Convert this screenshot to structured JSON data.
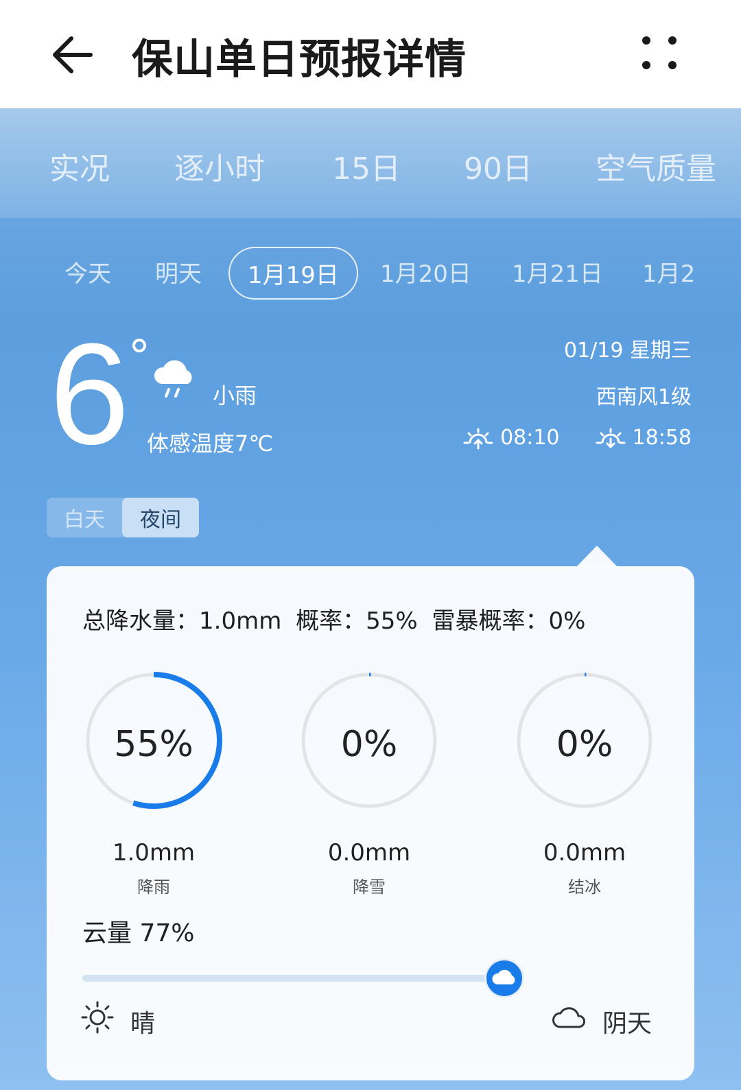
{
  "header": {
    "title": "保山单日预报详情"
  },
  "main_tabs": [
    {
      "label": "实况"
    },
    {
      "label": "逐小时"
    },
    {
      "label": "15日"
    },
    {
      "label": "90日"
    },
    {
      "label": "空气质量"
    }
  ],
  "date_tabs": [
    {
      "label": "今天"
    },
    {
      "label": "明天"
    },
    {
      "label": "1月19日",
      "selected": true
    },
    {
      "label": "1月20日"
    },
    {
      "label": "1月21日"
    },
    {
      "label": "1月2"
    }
  ],
  "summary": {
    "temperature": "6",
    "condition": "小雨",
    "condition_icon": "light-rain-icon",
    "feels_like": "体感温度7℃",
    "date": "01/19 星期三",
    "wind": "西南风1级",
    "sunrise": "08:10",
    "sunset": "18:58"
  },
  "toggle": {
    "day_label": "白天",
    "night_label": "夜间",
    "selected": "night"
  },
  "card": {
    "total_precip": "总降水量：1.0mm",
    "probability": "概率：55%",
    "thunder_probability": "雷暴概率：0%",
    "gauges": [
      {
        "value": "55%",
        "fraction": 0.55,
        "amount": "1.0mm",
        "label": "降雨"
      },
      {
        "value": "0%",
        "fraction": 0,
        "amount": "0.0mm",
        "label": "降雪"
      },
      {
        "value": "0%",
        "fraction": 0,
        "amount": "0.0mm",
        "label": "结冰"
      }
    ],
    "cloud_cover_label": "云量 77%",
    "cloud_cover_fraction": 0.77,
    "slider_left_label": "晴",
    "slider_right_label": "阴天"
  },
  "colors": {
    "accent": "#1a7ce8",
    "ring": "#e2e4e8"
  }
}
